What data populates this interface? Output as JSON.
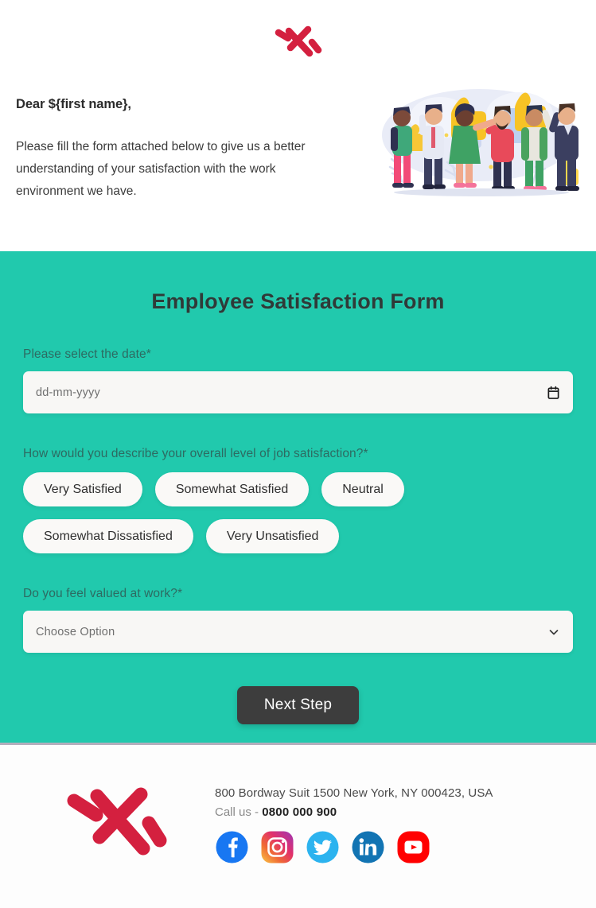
{
  "brand": {
    "logo_name": "brand-logo-x-mark",
    "logo_color": "#d4203f"
  },
  "header": {
    "greeting": "Dear ${first name},",
    "intro": "Please fill the form attached below to give us a better understanding of your satisfaction with the work environment we have.",
    "illustration_name": "people-thumbs-up-illustration"
  },
  "form": {
    "title": "Employee Satisfaction Form",
    "background_color": "#21c9ad",
    "date_field": {
      "label": "Please select the date*",
      "placeholder": "dd-mm-yyyy",
      "icon": "calendar-icon"
    },
    "satisfaction_question": {
      "label": "How would you describe your overall level of job satisfaction?*",
      "options": [
        "Very Satisfied",
        "Somewhat Satisfied",
        "Neutral",
        "Somewhat Dissatisfied",
        "Very Unsatisfied"
      ]
    },
    "valued_question": {
      "label": "Do you feel valued at work?*",
      "selected": "Choose Option",
      "icon": "chevron-down-icon"
    },
    "submit_label": "Next Step"
  },
  "footer": {
    "address": "800 Bordway Suit 1500 New York, NY 000423, USA",
    "call_prefix": "Call us -",
    "phone": "0800 000 900",
    "social": [
      {
        "name": "facebook-icon",
        "color": "#1877f2"
      },
      {
        "name": "instagram-icon",
        "color": "#e1306c"
      },
      {
        "name": "twitter-icon",
        "color": "#2cb3ef"
      },
      {
        "name": "linkedin-icon",
        "color": "#1274b3"
      },
      {
        "name": "youtube-icon",
        "color": "#ff0000"
      }
    ]
  }
}
